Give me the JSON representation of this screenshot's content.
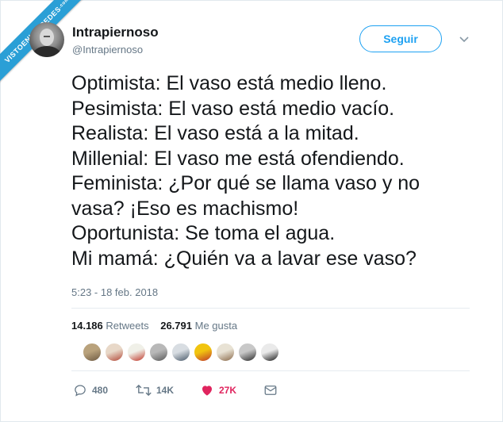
{
  "watermark": {
    "text": "VISTOENLASREDES",
    "suffix": ".com"
  },
  "user": {
    "name": "Intrapiernoso",
    "handle": "@Intrapiernoso"
  },
  "follow_label": "Seguir",
  "tweet_lines": [
    "Optimista: El vaso está medio lleno.",
    "Pesimista: El vaso está medio vacío.",
    "Realista: El vaso está a la mitad.",
    "Millenial: El vaso me está ofendiendo.",
    "Feminista: ¿Por qué se llama vaso y no",
    "vasa? ¡Eso es machismo!",
    "Oportunista: Se toma el agua.",
    "Mi mamá: ¿Quién va a lavar ese vaso?"
  ],
  "timestamp": "5:23 - 18 feb. 2018",
  "stats": {
    "retweets_count": "14.186",
    "retweets_label": "Retweets",
    "likes_count": "26.791",
    "likes_label": "Me gusta"
  },
  "liker_avatars": [
    {
      "colors": [
        "#b9a27c",
        "#6e5a43"
      ]
    },
    {
      "colors": [
        "#e8d8c8",
        "#b34a3a"
      ]
    },
    {
      "colors": [
        "#f0f0e8",
        "#c0392b"
      ]
    },
    {
      "colors": [
        "#b8b8b8",
        "#5a5a5a"
      ]
    },
    {
      "colors": [
        "#d8dde2",
        "#4a5a6a"
      ]
    },
    {
      "colors": [
        "#f1c40f",
        "#c0392b"
      ]
    },
    {
      "colors": [
        "#e8e2d4",
        "#8a6a4a"
      ]
    },
    {
      "colors": [
        "#c8c8c8",
        "#2a2a2a"
      ]
    },
    {
      "colors": [
        "#eaeaea",
        "#1a1a1a"
      ]
    }
  ],
  "actions": {
    "replies": "480",
    "retweets": "14K",
    "likes": "27K"
  },
  "colors": {
    "accent": "#1da1f2",
    "like": "#e0245e",
    "muted": "#657786",
    "watermark": "#2a9fd6"
  }
}
